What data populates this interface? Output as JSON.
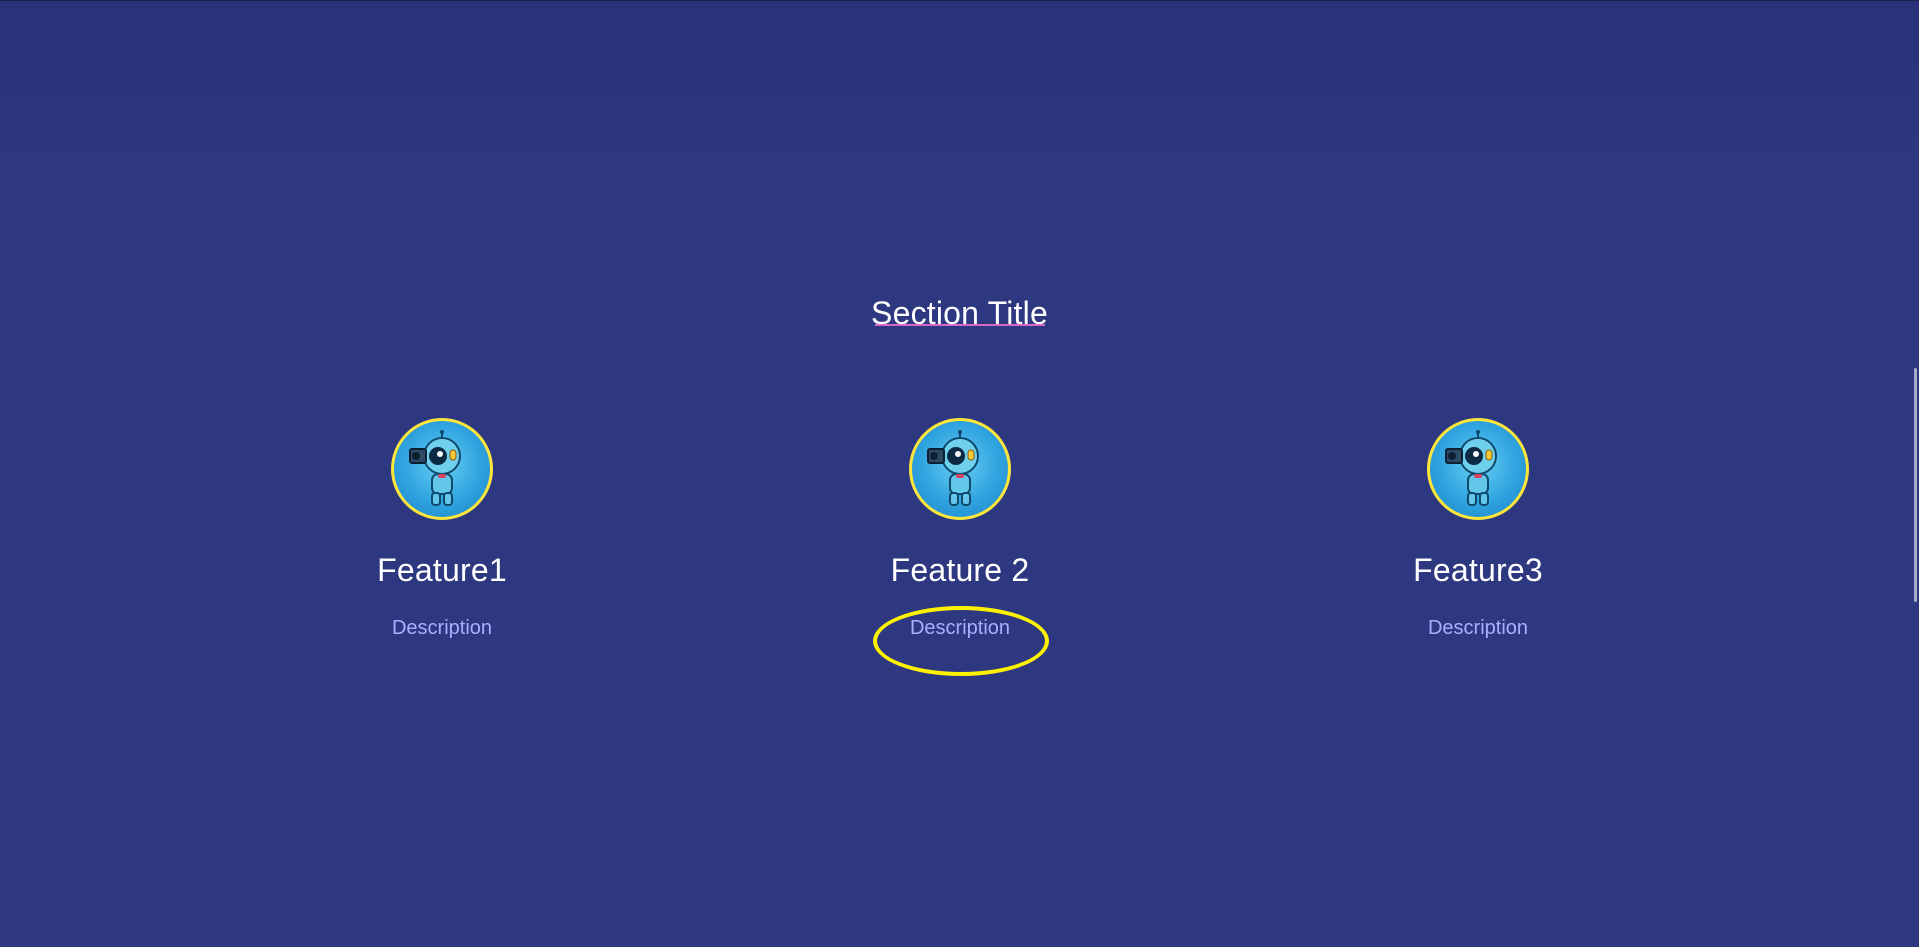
{
  "section": {
    "title": "Section Title"
  },
  "features": [
    {
      "title": "Feature1",
      "description": "Description",
      "icon": "robot-avatar-icon"
    },
    {
      "title": "Feature 2",
      "description": "Description",
      "icon": "robot-avatar-icon"
    },
    {
      "title": "Feature3",
      "description": "Description",
      "icon": "robot-avatar-icon"
    }
  ],
  "colors": {
    "background": "#2d3880",
    "title_underline": "#d668c8",
    "avatar_ring": "#ffe63a",
    "description_text": "#a7b0ff",
    "highlight_oval": "#fff200"
  }
}
